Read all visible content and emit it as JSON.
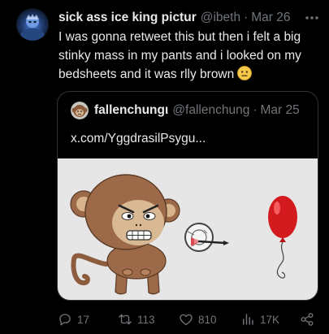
{
  "theme": {
    "background": "#000000",
    "text": "#e7e9ea",
    "muted": "#71767b",
    "border": "#2f3336",
    "media_background": "#e6e6e6",
    "monkey_color": "#9c6a48",
    "balloon_color": "#d31a1f"
  },
  "tweet": {
    "author": {
      "display_name": "sick ass ice king pictur",
      "handle": "@ibeth",
      "avatar_icon": "ice-king-avatar"
    },
    "separator": "·",
    "date": "Mar 26",
    "more_icon": "more-horizontal-icon",
    "text": "I was gonna retweet this but then i felt a big stinky mass in my pants and i looked on my bedsheets and it was rlly brown",
    "text_emoji_icon": "neutral-face-emoji-icon",
    "quote": {
      "author": {
        "display_name": "fallenchungι",
        "handle": "@fallenchung",
        "avatar_icon": "monkey-avatar"
      },
      "separator": "·",
      "date": "Mar 25",
      "text": "x.com/YggdrasilPsygu...",
      "media_icons": [
        "monkey-drawing",
        "dartboard-icon",
        "dart-icon",
        "red-balloon-icon"
      ]
    },
    "actions": {
      "reply": {
        "icon": "reply-icon",
        "count": "17"
      },
      "retweet": {
        "icon": "retweet-icon",
        "count": "113"
      },
      "like": {
        "icon": "heart-icon",
        "count": "810"
      },
      "views": {
        "icon": "views-icon",
        "count": "17K"
      },
      "share": {
        "icon": "share-icon"
      }
    }
  }
}
